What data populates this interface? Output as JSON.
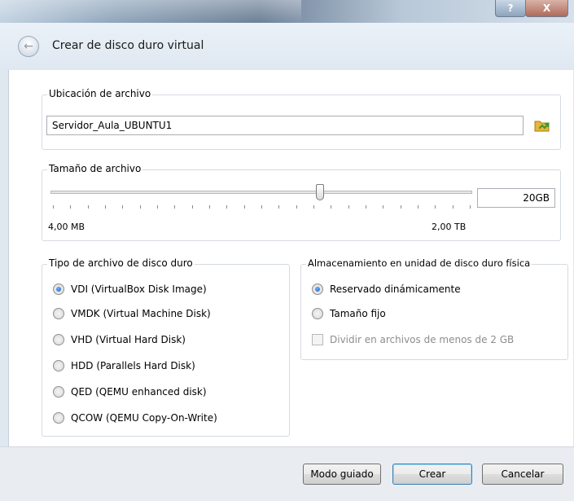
{
  "window": {
    "help_label": "?",
    "close_label": "X",
    "title": "Crear de disco duro virtual"
  },
  "location": {
    "group_label": "Ubicación de archivo",
    "value": "Servidor_Aula_UBUNTU1",
    "browse_icon": "folder-icon"
  },
  "size": {
    "group_label": "Tamaño de archivo",
    "value": "20GB",
    "min_label": "4,00 MB",
    "max_label": "2,00 TB",
    "slider_fraction": 0.64,
    "tick_count": 25
  },
  "file_type": {
    "group_label": "Tipo de archivo de disco duro",
    "options": [
      {
        "label": "VDI (VirtualBox Disk Image)",
        "selected": true
      },
      {
        "label": "VMDK (Virtual Machine Disk)",
        "selected": false
      },
      {
        "label": "VHD (Virtual Hard Disk)",
        "selected": false
      },
      {
        "label": "HDD (Parallels Hard Disk)",
        "selected": false
      },
      {
        "label": "QED (QEMU enhanced disk)",
        "selected": false
      },
      {
        "label": "QCOW (QEMU Copy-On-Write)",
        "selected": false
      }
    ]
  },
  "storage": {
    "group_label": "Almacenamiento en unidad de disco duro física",
    "options": [
      {
        "label": "Reservado dinámicamente",
        "selected": true
      },
      {
        "label": "Tamaño fijo",
        "selected": false
      }
    ],
    "split_label": "Dividir en archivos de menos de 2 GB",
    "split_checked": false
  },
  "buttons": {
    "guided": "Modo guiado",
    "create": "Crear",
    "cancel": "Cancelar"
  },
  "colors": {
    "folder": "#e8b53a",
    "arrow": "#3a9a2b"
  }
}
